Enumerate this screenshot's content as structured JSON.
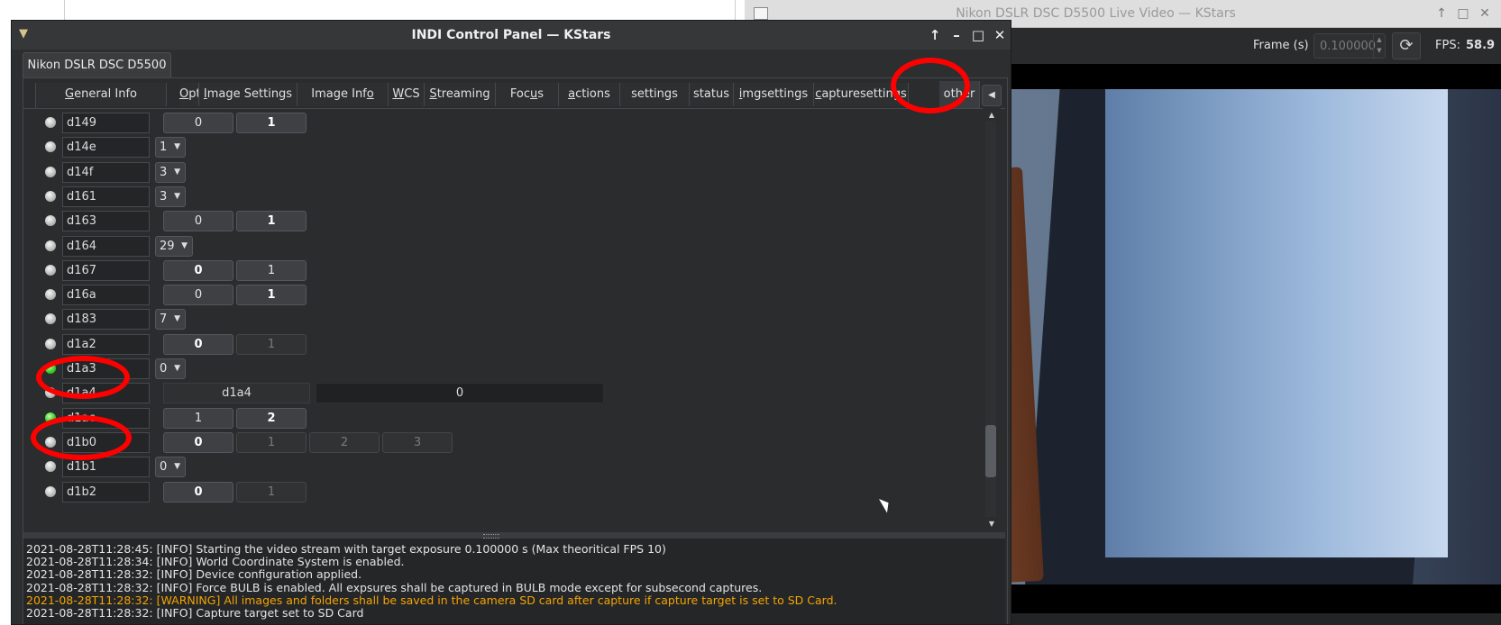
{
  "video_window": {
    "title": "Nikon DSLR DSC D5500 Live Video — KStars",
    "frame_label": "Frame (s)",
    "frame_value": "0.100000",
    "fps_label": "FPS:",
    "fps_value": "58.9"
  },
  "panel_window": {
    "title": "INDI Control Panel — KStars",
    "device_tab": "Nikon DSLR DSC D5500",
    "tabs": [
      {
        "pre": "",
        "u": "G",
        "post": "eneral Info"
      },
      {
        "pre": "",
        "u": "O",
        "post": "ptions"
      },
      {
        "pre": "",
        "u": "I",
        "post": "mage Settings"
      },
      {
        "pre": "Image Inf",
        "u": "o",
        "post": ""
      },
      {
        "pre": "",
        "u": "W",
        "post": "CS"
      },
      {
        "pre": "",
        "u": "S",
        "post": "treaming"
      },
      {
        "pre": "Foc",
        "u": "u",
        "post": "s"
      },
      {
        "pre": "",
        "u": "a",
        "post": "ctions"
      },
      {
        "pre": "settings",
        "u": "",
        "post": ""
      },
      {
        "pre": "status",
        "u": "",
        "post": ""
      },
      {
        "pre": "",
        "u": "i",
        "post": "mgsettings"
      },
      {
        "pre": "",
        "u": "c",
        "post": "apturesettings"
      },
      {
        "pre": "other",
        "u": "",
        "post": ""
      }
    ],
    "properties": [
      {
        "name": "d149",
        "type": "switch",
        "leds": "idle",
        "options": [
          "0",
          "1"
        ],
        "on": 1
      },
      {
        "name": "d14e",
        "type": "combo",
        "leds": "idle",
        "value": "1"
      },
      {
        "name": "d14f",
        "type": "combo",
        "leds": "idle",
        "value": "3"
      },
      {
        "name": "d161",
        "type": "combo",
        "leds": "idle",
        "value": "3"
      },
      {
        "name": "d163",
        "type": "switch",
        "leds": "idle",
        "options": [
          "0",
          "1"
        ],
        "on": 1
      },
      {
        "name": "d164",
        "type": "combo",
        "leds": "idle",
        "value": "29"
      },
      {
        "name": "d167",
        "type": "switch",
        "leds": "idle",
        "options": [
          "0",
          "1"
        ],
        "on": 0
      },
      {
        "name": "d16a",
        "type": "switch",
        "leds": "idle",
        "options": [
          "0",
          "1"
        ],
        "on": 1
      },
      {
        "name": "d183",
        "type": "combo",
        "leds": "idle",
        "value": "7"
      },
      {
        "name": "d1a2",
        "type": "switch",
        "leds": "idle",
        "options": [
          "0",
          "1"
        ],
        "on": 0,
        "disabled": [
          1
        ]
      },
      {
        "name": "d1a3",
        "type": "combo",
        "leds": "ok",
        "value": "0"
      },
      {
        "name": "d1a4",
        "type": "text",
        "leds": "idle",
        "label": "d1a4",
        "value": "0"
      },
      {
        "name": "d1ac",
        "type": "switch",
        "leds": "ok",
        "options": [
          "1",
          "2"
        ],
        "on": 1
      },
      {
        "name": "d1b0",
        "type": "switch",
        "leds": "idle",
        "options": [
          "0",
          "1",
          "2",
          "3"
        ],
        "on": 0,
        "disabled": [
          1,
          2,
          3
        ]
      },
      {
        "name": "d1b1",
        "type": "combo",
        "leds": "idle",
        "value": "0"
      },
      {
        "name": "d1b2",
        "type": "switch",
        "leds": "idle",
        "options": [
          "0",
          "1"
        ],
        "on": 0,
        "disabled": [
          1
        ]
      }
    ],
    "log": [
      {
        "text": "2021-08-28T11:28:45: [INFO] Starting the video stream with target exposure 0.100000 s (Max theoritical FPS 10)",
        "level": "info"
      },
      {
        "text": "2021-08-28T11:28:34: [INFO] World Coordinate System is enabled.",
        "level": "info"
      },
      {
        "text": "2021-08-28T11:28:32: [INFO] Device configuration applied.",
        "level": "info"
      },
      {
        "text": "2021-08-28T11:28:32: [INFO] Force BULB is enabled. All expsures shall be captured in BULB mode except for subsecond captures.",
        "level": "info"
      },
      {
        "text": "2021-08-28T11:28:32: [WARNING] All images and folders shall be saved in the camera SD card after capture if capture target is set to SD Card.",
        "level": "warn"
      },
      {
        "text": "2021-08-28T11:28:32: [INFO] Capture target set to SD Card",
        "level": "info"
      }
    ]
  },
  "colors": {
    "warning": "#f6a400",
    "annotation": "#ff0000",
    "led_ok": "#3ed62e"
  }
}
